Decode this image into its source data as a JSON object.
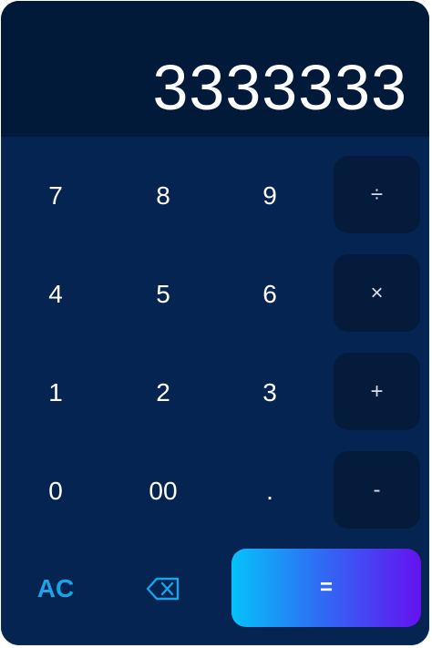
{
  "display": {
    "value": "3333333"
  },
  "keys": {
    "seven": "7",
    "eight": "8",
    "nine": "9",
    "divide": "÷",
    "four": "4",
    "five": "5",
    "six": "6",
    "multiply": "×",
    "one": "1",
    "two": "2",
    "three": "3",
    "plus": "+",
    "zero": "0",
    "double_zero": "00",
    "decimal": ".",
    "minus": "-",
    "clear": "AC",
    "equals": "="
  },
  "icons": {
    "backspace": "backspace-icon"
  },
  "colors": {
    "background": "#062451",
    "display_bg": "#021a3a",
    "operator_bg": "#041b3c",
    "accent": "#1aa3e6",
    "equals_gradient_start": "#05c2fb",
    "equals_gradient_end": "#6412f0"
  }
}
